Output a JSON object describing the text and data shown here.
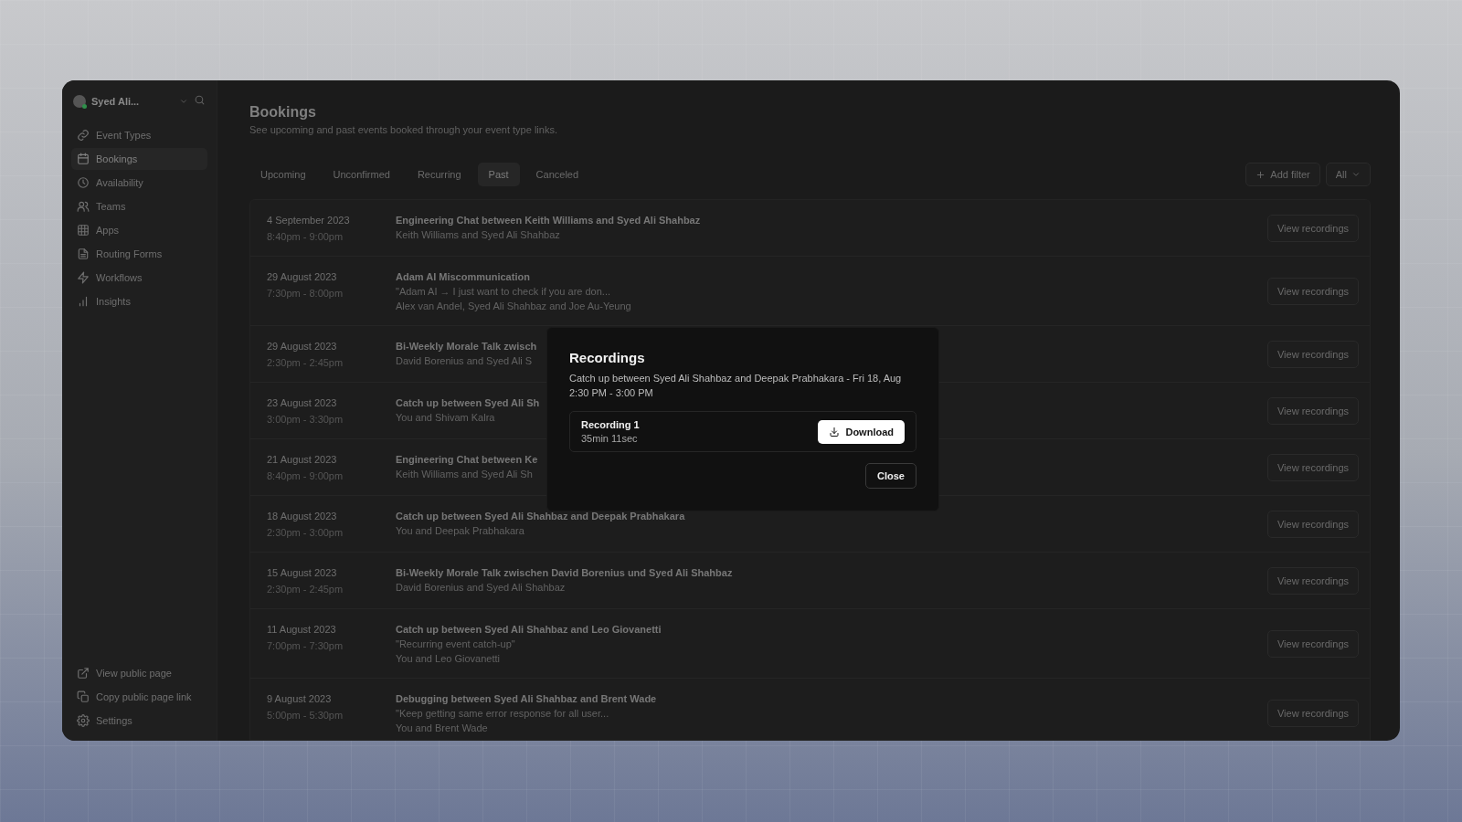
{
  "sidebar": {
    "user": {
      "name": "Syed Ali..."
    },
    "nav": [
      {
        "label": "Event Types",
        "selected": false
      },
      {
        "label": "Bookings",
        "selected": true
      },
      {
        "label": "Availability",
        "selected": false
      },
      {
        "label": "Teams",
        "selected": false
      },
      {
        "label": "Apps",
        "selected": false
      },
      {
        "label": "Routing Forms",
        "selected": false
      },
      {
        "label": "Workflows",
        "selected": false
      },
      {
        "label": "Insights",
        "selected": false
      }
    ],
    "footer_nav": [
      {
        "label": "View public page"
      },
      {
        "label": "Copy public page link"
      },
      {
        "label": "Settings"
      }
    ]
  },
  "header": {
    "title": "Bookings",
    "subtitle": "See upcoming and past events booked through your event type links."
  },
  "tabs": [
    {
      "label": "Upcoming",
      "selected": false
    },
    {
      "label": "Unconfirmed",
      "selected": false
    },
    {
      "label": "Recurring",
      "selected": false
    },
    {
      "label": "Past",
      "selected": true
    },
    {
      "label": "Canceled",
      "selected": false
    }
  ],
  "filters": {
    "add_filter": "Add filter",
    "select": "All"
  },
  "bookings": [
    {
      "date": "4 September 2023",
      "time": "8:40pm - 9:00pm",
      "title": "Engineering Chat between Keith Williams and Syed Ali Shahbaz",
      "attendees": "Keith Williams and Syed Ali Shahbaz",
      "action": "View recordings"
    },
    {
      "date": "29 August 2023",
      "time": "7:30pm - 8:00pm",
      "title": "Adam AI Miscommunication",
      "description": "\"Adam AI → I just want to check if you are don...",
      "attendees": "Alex van Andel, Syed Ali Shahbaz and Joe Au-Yeung",
      "action": "View recordings"
    },
    {
      "date": "29 August 2023",
      "time": "2:30pm - 2:45pm",
      "title": "Bi-Weekly Morale Talk zwisch",
      "attendees": "David Borenius and Syed Ali S",
      "action": "View recordings"
    },
    {
      "date": "23 August 2023",
      "time": "3:00pm - 3:30pm",
      "title": "Catch up between Syed Ali Sh",
      "attendees": "You and Shivam Kalra",
      "action": "View recordings"
    },
    {
      "date": "21 August 2023",
      "time": "8:40pm - 9:00pm",
      "title": "Engineering Chat between Ke",
      "attendees": "Keith Williams and Syed Ali Sh",
      "action": "View recordings"
    },
    {
      "date": "18 August 2023",
      "time": "2:30pm - 3:00pm",
      "title": "Catch up between Syed Ali Shahbaz and Deepak Prabhakara",
      "attendees": "You and Deepak Prabhakara",
      "action": "View recordings"
    },
    {
      "date": "15 August 2023",
      "time": "2:30pm - 2:45pm",
      "title": "Bi-Weekly Morale Talk zwischen David Borenius und Syed Ali Shahbaz",
      "attendees": "David Borenius and Syed Ali Shahbaz",
      "action": "View recordings"
    },
    {
      "date": "11 August 2023",
      "time": "7:00pm - 7:30pm",
      "title": "Catch up between Syed Ali Shahbaz and Leo Giovanetti",
      "description": "\"Recurring event catch-up\"",
      "attendees": "You and Leo Giovanetti",
      "action": "View recordings"
    },
    {
      "date": "9 August 2023",
      "time": "5:00pm - 5:30pm",
      "title": "Debugging between Syed Ali Shahbaz and Brent Wade",
      "description": "\"Keep getting same error response for all user...",
      "attendees": "You and Brent Wade",
      "action": "View recordings"
    }
  ],
  "modal": {
    "title": "Recordings",
    "subtitle": "Catch up between Syed Ali Shahbaz and Deepak Prabhakara - Fri 18, Aug 2:30 PM - 3:00 PM",
    "recordings": [
      {
        "name": "Recording 1",
        "duration": "35min 11sec",
        "action": "Download"
      }
    ],
    "close": "Close"
  }
}
